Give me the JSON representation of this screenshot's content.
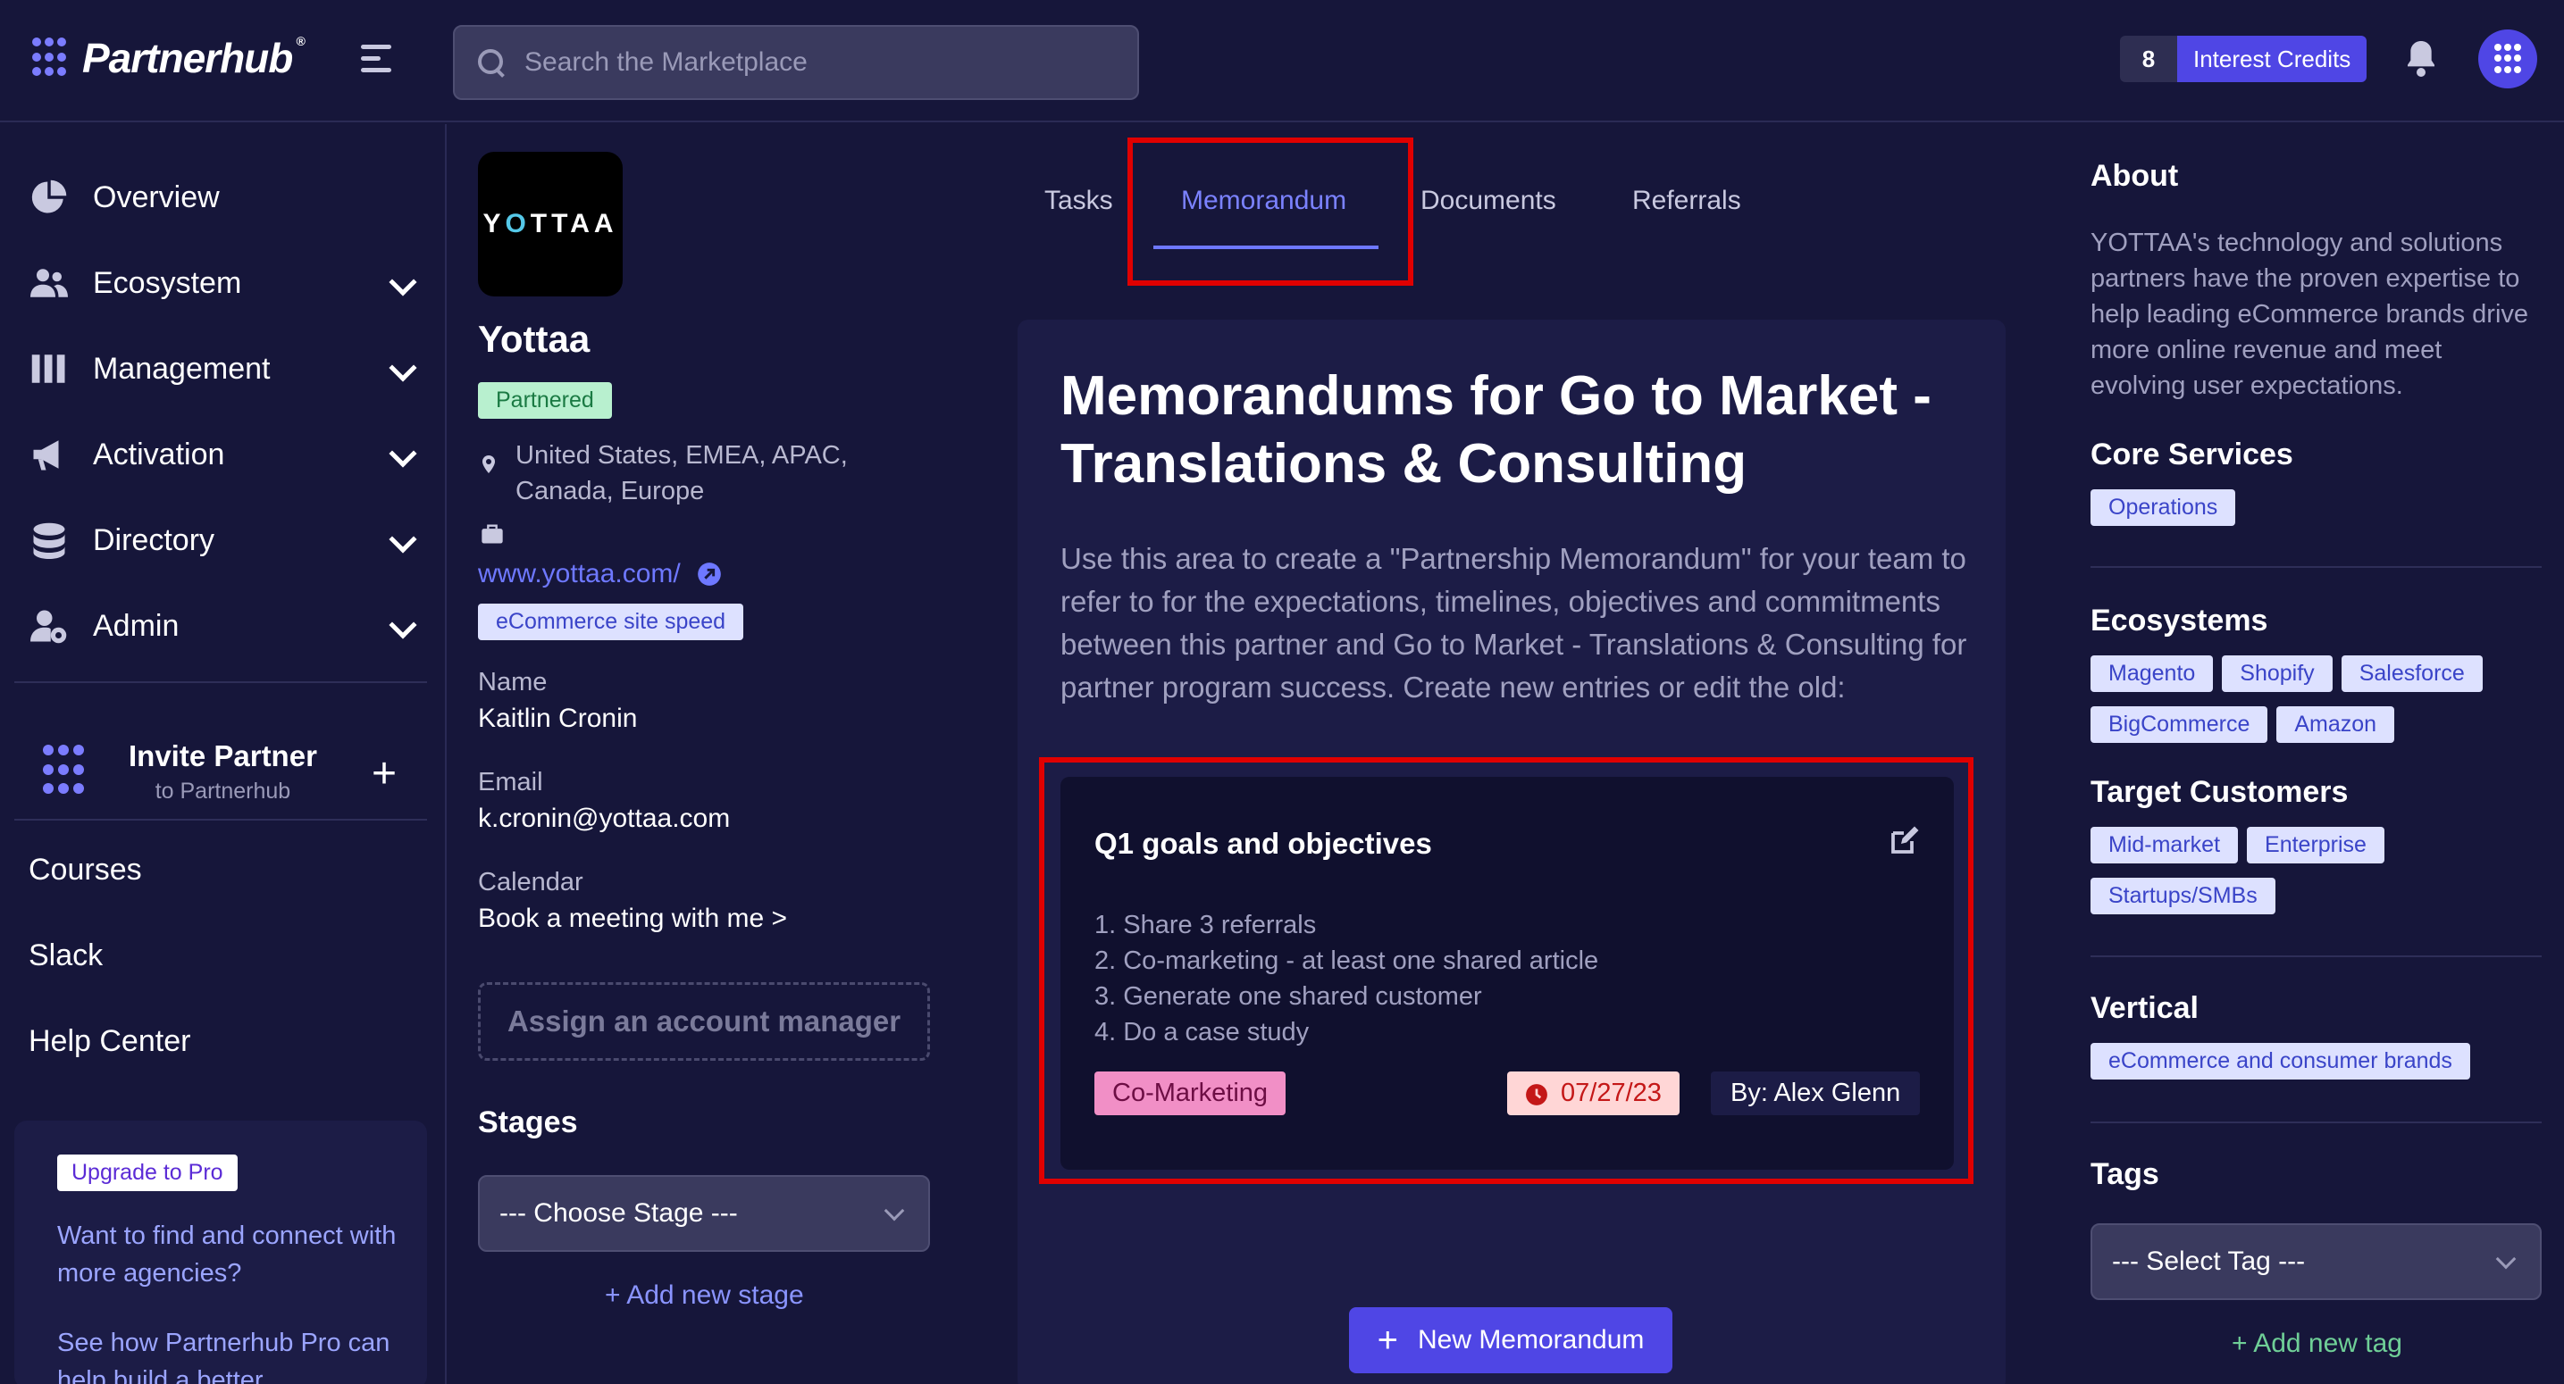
{
  "app": {
    "name": "Partnerhub",
    "reg": "®"
  },
  "search": {
    "placeholder": "Search the Marketplace"
  },
  "header": {
    "credits_count": "8",
    "credits_label": "Interest Credits"
  },
  "sidebar": {
    "items": [
      {
        "label": "Overview"
      },
      {
        "label": "Ecosystem"
      },
      {
        "label": "Management"
      },
      {
        "label": "Activation"
      },
      {
        "label": "Directory"
      },
      {
        "label": "Admin"
      }
    ],
    "invite_title": "Invite Partner",
    "invite_sub": "to Partnerhub",
    "invite_plus": "+",
    "links": [
      {
        "label": "Courses"
      },
      {
        "label": "Slack"
      },
      {
        "label": "Help Center"
      }
    ],
    "promo": {
      "badge": "Upgrade to Pro",
      "text": "Want to find and connect with more agencies?",
      "text2": "See how Partnerhub Pro can help build a better"
    }
  },
  "company": {
    "logo_text_1": "Y",
    "logo_text_o": "O",
    "logo_text_2": "TTAA",
    "name": "Yottaa",
    "status": "Partnered",
    "location": "United States, EMEA, APAC, Canada, Europe",
    "website": "www.yottaa.com/",
    "site_tag": "eCommerce site speed",
    "name_label": "Name",
    "name_value": "Kaitlin Cronin",
    "email_label": "Email",
    "email_value": "k.cronin@yottaa.com",
    "calendar_label": "Calendar",
    "calendar_value": "Book a meeting with me >",
    "assign_label": "Assign an account manager",
    "stages_title": "Stages",
    "stage_select": "--- Choose Stage ---",
    "add_stage": "+ Add new stage"
  },
  "tabs": [
    {
      "label": "Tasks"
    },
    {
      "label": "Memorandum"
    },
    {
      "label": "Documents"
    },
    {
      "label": "Referrals"
    }
  ],
  "main": {
    "title": "Memorandums for Go to Market - Translations & Consulting",
    "description": "Use this area to create a \"Partnership Memorandum\" for your team to refer to for the expectations, timelines, objectives and commitments between this partner and Go to Market - Translations & Consulting for partner program success. Create new entries or edit the old:",
    "memo": {
      "title": "Q1 goals and objectives",
      "items": [
        "1. Share 3 referrals",
        "2. Co-marketing - at least one shared article",
        "3. Generate one shared customer",
        "4. Do a case study"
      ],
      "category": "Co-Marketing",
      "date": "07/27/23",
      "author": "By: Alex Glenn"
    },
    "new_button": "New Memorandum"
  },
  "right": {
    "about_title": "About",
    "about_text": "YOTTAA's technology and solutions partners have the proven expertise to help leading eCommerce brands drive more online revenue and meet evolving user expectations.",
    "core_title": "Core Services",
    "core_chips": [
      "Operations"
    ],
    "eco_title": "Ecosystems",
    "eco_chips": [
      "Magento",
      "Shopify",
      "Salesforce",
      "BigCommerce",
      "Amazon"
    ],
    "target_title": "Target Customers",
    "target_chips": [
      "Mid-market",
      "Enterprise",
      "Startups/SMBs"
    ],
    "vertical_title": "Vertical",
    "vertical_chips": [
      "eCommerce and consumer brands"
    ],
    "tags_title": "Tags",
    "tag_select": "--- Select Tag ---",
    "add_tag": "+ Add new tag"
  },
  "colors": {
    "background": "#16163a",
    "panel": "#1c1c46",
    "accent": "#4f46e5",
    "highlight": "#e00000",
    "partnered": "#b8f0cf",
    "co_marketing": "#f18fc6"
  },
  "icons": [
    "search-icon",
    "bell-icon",
    "menu-icon",
    "pie-chart-icon",
    "users-icon",
    "bars-icon",
    "megaphone-icon",
    "database-icon",
    "user-gear-icon",
    "pin-icon",
    "briefcase-icon",
    "external-link-icon",
    "edit-icon",
    "clock-icon",
    "plus-icon",
    "chevron-down-icon"
  ]
}
